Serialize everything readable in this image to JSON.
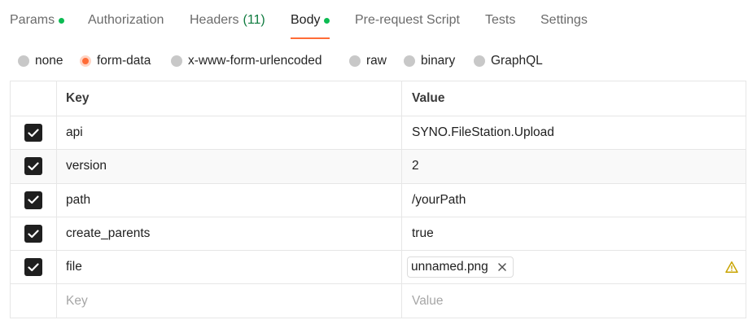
{
  "tabs": {
    "params": "Params",
    "authorization": "Authorization",
    "headers": "Headers",
    "headers_count": "(11)",
    "body": "Body",
    "prerequest": "Pre-request Script",
    "tests": "Tests",
    "settings": "Settings",
    "active": "Body"
  },
  "body_types": {
    "none": "none",
    "form_data": "form-data",
    "urlencoded": "x-www-form-urlencoded",
    "raw": "raw",
    "binary": "binary",
    "graphql": "GraphQL",
    "selected": "form-data"
  },
  "table": {
    "headers": {
      "key": "Key",
      "value": "Value"
    },
    "rows": [
      {
        "checked": true,
        "key": "api",
        "value": "SYNO.FileStation.Upload"
      },
      {
        "checked": true,
        "key": "version",
        "value": "2"
      },
      {
        "checked": true,
        "key": "path",
        "value": "/yourPath"
      },
      {
        "checked": true,
        "key": "create_parents",
        "value": "true"
      },
      {
        "checked": true,
        "key": "file",
        "value": "unnamed.png",
        "type": "file"
      }
    ],
    "new_row": {
      "key_placeholder": "Key",
      "value_placeholder": "Value"
    }
  },
  "icons": {
    "checkbox": "check-icon",
    "chip_close": "close-icon",
    "warning": "warning-icon"
  },
  "colors": {
    "accent": "#ff6c37",
    "dot_green": "#0cbb52",
    "count_green": "#0f7b3f",
    "warning": "#c9a400"
  }
}
